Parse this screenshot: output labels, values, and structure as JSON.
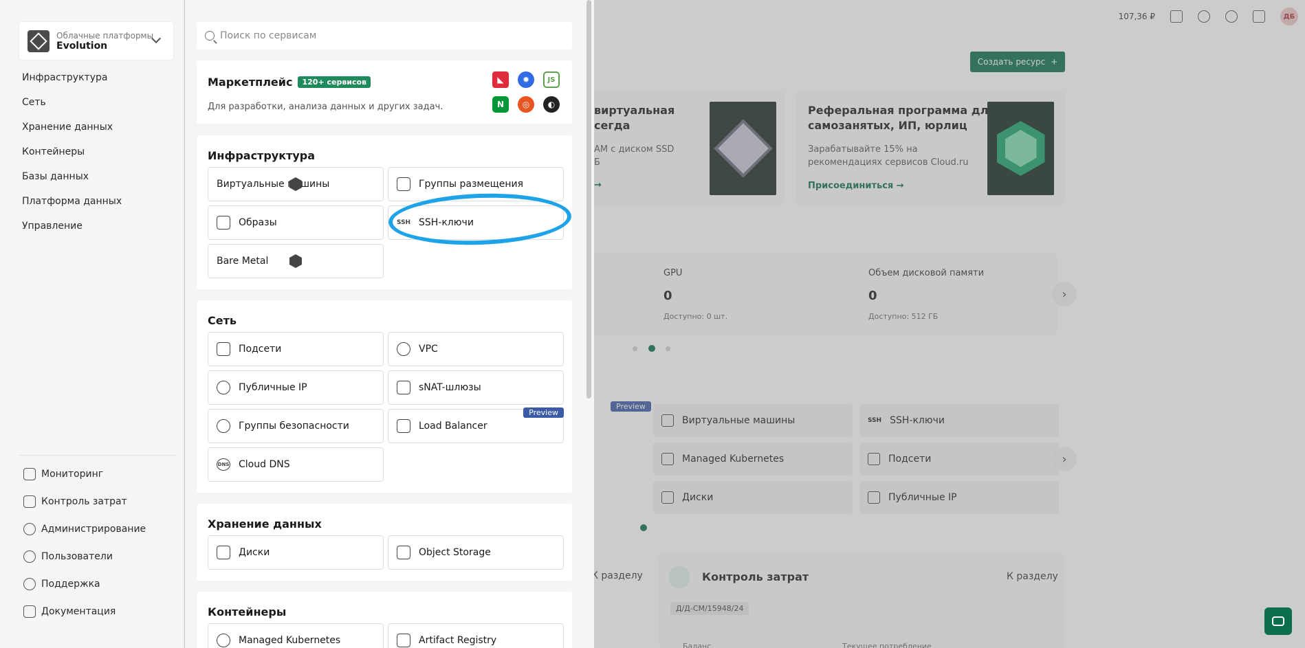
{
  "topbar": {
    "balance": "107,36 ₽",
    "avatar": "ДБ"
  },
  "bg": {
    "create_button": "Создать ресурс",
    "promo1": {
      "title_line1": "виртуальная",
      "title_line2": "сегда",
      "sub_line1": "АМ с диском SSD",
      "sub_line2": "Б"
    },
    "promo2": {
      "title_line1": "Реферальная программа для",
      "title_line2": "самозанятых, ИП, юрлиц",
      "sub_line1": "Зарабатывайте 15% на",
      "sub_line2": "рекомендациях сервисов Cloud.ru",
      "link": "Присоединиться"
    },
    "stats": [
      {
        "label": "GPU",
        "value": "0",
        "sub": "Доступно: 0 шт."
      },
      {
        "label": "Объем дисковой памяти",
        "value": "0",
        "sub": "Доступно: 512 ГБ"
      }
    ],
    "preview_badge": "Preview",
    "tiles": [
      {
        "label": "Виртуальные машины",
        "icon": "hexagon-icon"
      },
      {
        "label": "SSH-ключи",
        "icon": "ssh-icon"
      },
      {
        "label": "Managed Kubernetes",
        "icon": "kubernetes-icon"
      },
      {
        "label": "Подсети",
        "icon": "network-icon"
      },
      {
        "label": "Диски",
        "icon": "disk-icon"
      },
      {
        "label": "Публичные IP",
        "icon": "ip-icon"
      }
    ],
    "section_link_left": "К разделу",
    "cost": {
      "title": "Контроль затрат",
      "link": "К разделу",
      "contract": "Д/Д-CM/15948/24",
      "col1": "Баланс",
      "col2": "Текущее потребление"
    }
  },
  "nav": {
    "platform_small": "Облачные платформы",
    "platform_big": "Evolution",
    "items": [
      "Инфраструктура",
      "Сеть",
      "Хранение данных",
      "Контейнеры",
      "Базы данных",
      "Платформа данных",
      "Управление"
    ],
    "bottom": [
      "Мониторинг",
      "Контроль затрат",
      "Администрирование",
      "Пользователи",
      "Поддержка",
      "Документация"
    ]
  },
  "panel": {
    "search_placeholder": "Поиск по сервисам",
    "marketplace": {
      "title": "Маркетплейс",
      "badge": "120+ сервисов",
      "subtitle": "Для разработки, анализа данных и других задач."
    },
    "infrastructure": {
      "title": "Инфраструктура",
      "tiles": [
        "Виртуальные машины",
        "Группы размещения",
        "Образы",
        "SSH-ключи",
        "Bare Metal"
      ]
    },
    "network": {
      "title": "Сеть",
      "tiles": [
        "Подсети",
        "VPC",
        "Публичные IP",
        "sNAT-шлюзы",
        "Группы безопасности",
        "Load Balancer",
        "Cloud DNS"
      ],
      "preview": "Preview"
    },
    "storage": {
      "title": "Хранение данных",
      "tiles": [
        "Диски",
        "Object Storage"
      ]
    },
    "containers": {
      "title": "Контейнеры",
      "tiles": [
        "Managed Kubernetes",
        "Artifact Registry"
      ]
    }
  },
  "colors": {
    "accent": "#0b6e4f",
    "badge": "#1f8a5a",
    "preview": "#3b5ba9",
    "annotation": "#1ea3e8"
  }
}
